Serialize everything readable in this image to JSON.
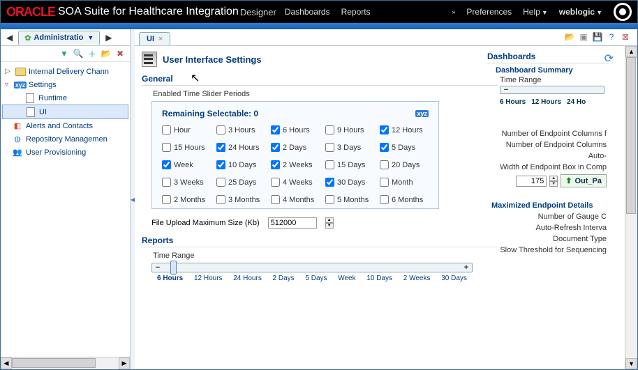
{
  "header": {
    "logo": "ORACLE",
    "title": "SOA Suite for Healthcare Integration",
    "subtitle": "Designer",
    "nav": [
      "Dashboards",
      "Reports"
    ],
    "preferences": "Preferences",
    "help": "Help",
    "user": "weblogic"
  },
  "sidebar": {
    "tab": "Administratio",
    "tree": {
      "internal_delivery": "Internal Delivery Chann",
      "settings": "Settings",
      "runtime": "Runtime",
      "ui": "UI",
      "alerts": "Alerts and Contacts",
      "repo": "Repository Managemen",
      "user_prov": "User Provisioning"
    }
  },
  "content": {
    "tab": "UI",
    "title": "User Interface Settings",
    "general": {
      "heading": "General",
      "enabled_label": "Enabled Time Slider Periods",
      "remaining_label": "Remaining Selectable: 0",
      "periods": [
        {
          "label": "Hour",
          "checked": false
        },
        {
          "label": "3 Hours",
          "checked": false
        },
        {
          "label": "6 Hours",
          "checked": true
        },
        {
          "label": "9 Hours",
          "checked": false
        },
        {
          "label": "12 Hours",
          "checked": true
        },
        {
          "label": "15 Hours",
          "checked": false
        },
        {
          "label": "24 Hours",
          "checked": true
        },
        {
          "label": "2 Days",
          "checked": true
        },
        {
          "label": "3 Days",
          "checked": false
        },
        {
          "label": "5 Days",
          "checked": true
        },
        {
          "label": "Week",
          "checked": true
        },
        {
          "label": "10 Days",
          "checked": true
        },
        {
          "label": "2 Weeks",
          "checked": true
        },
        {
          "label": "15 Days",
          "checked": false
        },
        {
          "label": "20 Days",
          "checked": false
        },
        {
          "label": "3 Weeks",
          "checked": false
        },
        {
          "label": "25 Days",
          "checked": false
        },
        {
          "label": "4 Weeks",
          "checked": false
        },
        {
          "label": "30 Days",
          "checked": true
        },
        {
          "label": "Month",
          "checked": false
        },
        {
          "label": "2 Months",
          "checked": false
        },
        {
          "label": "3 Months",
          "checked": false
        },
        {
          "label": "4 Months",
          "checked": false
        },
        {
          "label": "5 Months",
          "checked": false
        },
        {
          "label": "6 Months",
          "checked": false
        }
      ],
      "file_upload_label": "File Upload Maximum Size (Kb)",
      "file_upload_value": "512000"
    },
    "reports": {
      "heading": "Reports",
      "time_range_label": "Time Range",
      "ticks": [
        "6 Hours",
        "12 Hours",
        "24 Hours",
        "2 Days",
        "5 Days",
        "Week",
        "10 Days",
        "2 Weeks",
        "30 Days"
      ]
    },
    "dashboards": {
      "heading": "Dashboards",
      "summary": "Dashboard Summary",
      "time_range_label": "Time Range",
      "ticks": [
        "6 Hours",
        "12 Hours",
        "24 Ho"
      ],
      "endpoint_cols_a": "Number of Endpoint Columns f",
      "endpoint_cols_b": "Number of Endpoint Columns",
      "auto": "Auto-",
      "width_label": "Width of Endpoint Box in Comp",
      "width_value": "175",
      "out_label": "Out_Pa",
      "maximized_heading": "Maximized Endpoint Details",
      "gauge": "Number of Gauge C",
      "auto_refresh": "Auto-Refresh Interva",
      "doc_type": "Document Type",
      "slow_threshold": "Slow Threshold for Sequencing"
    }
  }
}
